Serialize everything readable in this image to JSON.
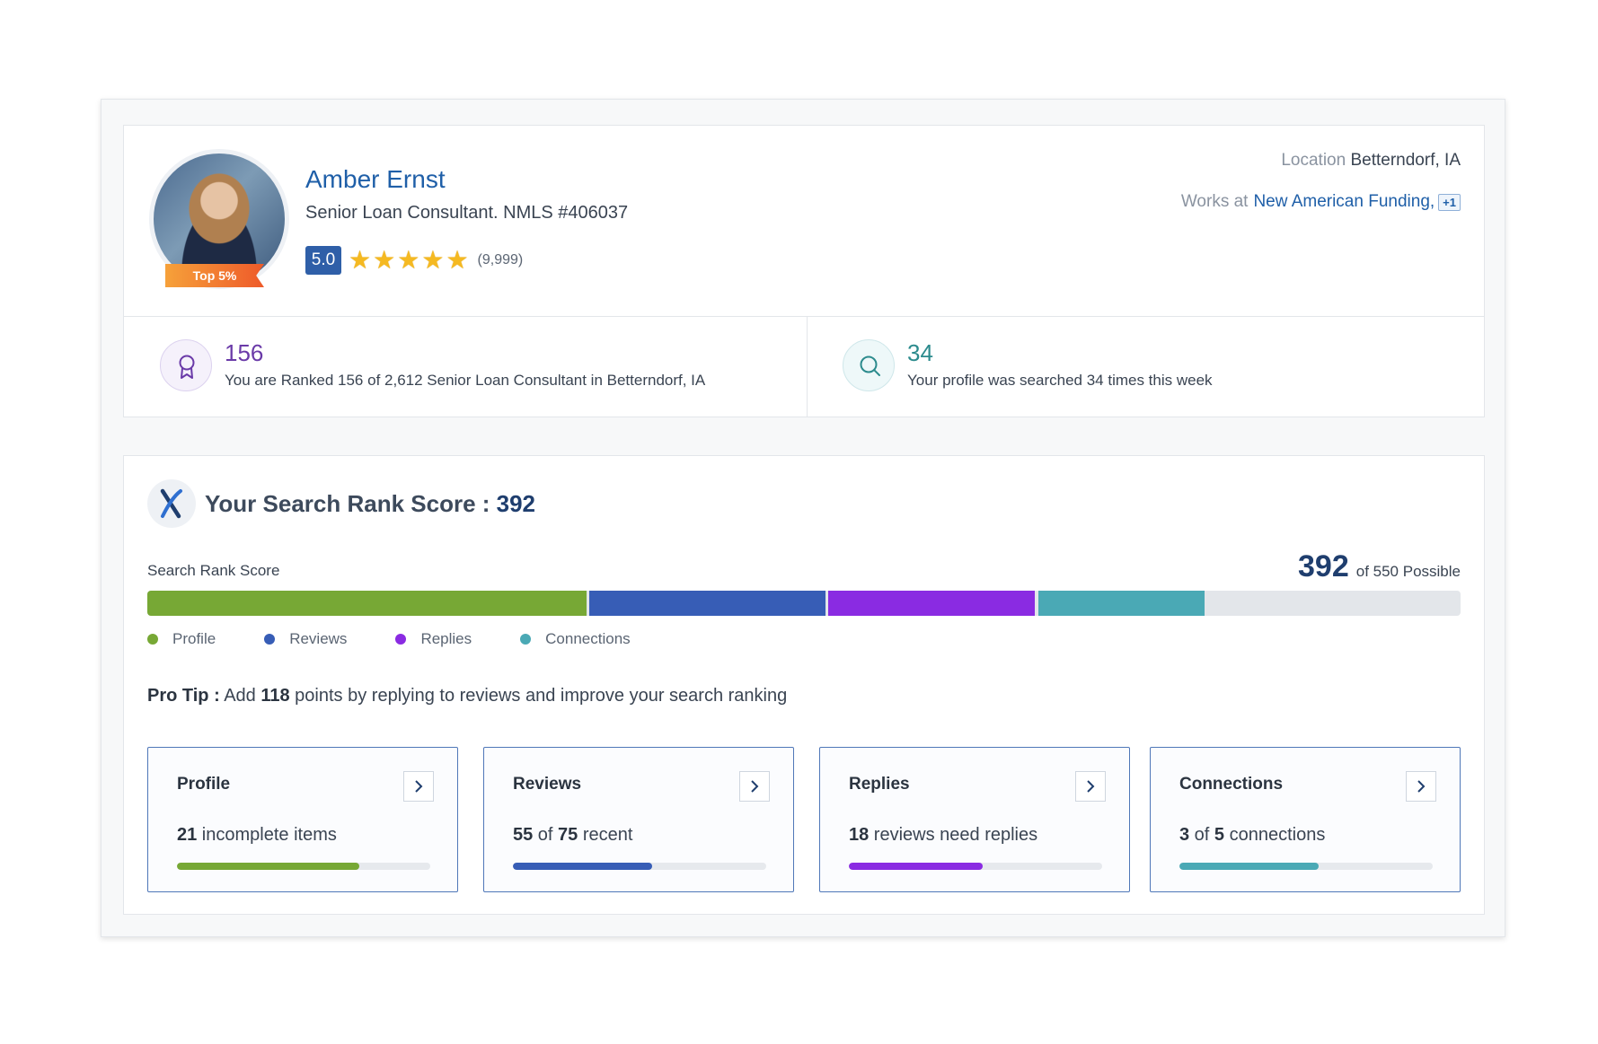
{
  "profile": {
    "name": "Amber Ernst",
    "title": "Senior Loan Consultant. NMLS #406037",
    "top_badge": "Top 5%",
    "rating": "5.0",
    "stars": 5,
    "rating_count": "(9,999)",
    "location_label": "Location",
    "location": "Betterndorf, IA",
    "works_label": "Works at",
    "company": "New American Funding,",
    "extra_companies": "+1"
  },
  "stats": [
    {
      "icon": "ribbon-award-icon",
      "value": "156",
      "text": "You are Ranked 156 of 2,612 Senior Loan Consultant in Betterndorf, IA"
    },
    {
      "icon": "search-icon",
      "value": "34",
      "text": "Your profile was searched 34 times this week"
    }
  ],
  "score": {
    "heading": "Your Search Rank Score : ",
    "value": "392",
    "bar_label": "Search Rank Score",
    "total_value": "392",
    "total_suffix": "of 550 Possible",
    "max": 550,
    "segments": [
      {
        "name": "Profile",
        "points": 185,
        "color": "#77a835"
      },
      {
        "name": "Reviews",
        "points": 100,
        "color": "#375db6"
      },
      {
        "name": "Replies",
        "points": 88,
        "color": "#8a2be2"
      },
      {
        "name": "Connections",
        "points": 71,
        "color": "#4aa9b5"
      }
    ],
    "legend": [
      "Profile",
      "Reviews",
      "Replies",
      "Connections"
    ],
    "pro_tip_label": "Pro Tip :",
    "pro_tip_pre": " Add ",
    "pro_tip_points": "118",
    "pro_tip_post": " points by replying to reviews and improve your search ranking"
  },
  "cards": [
    {
      "title": "Profile",
      "strong": "21",
      "text": " incomplete items",
      "progress": 0.72,
      "color": "#77a835"
    },
    {
      "title": "Reviews",
      "strong": "55",
      "mid": " of ",
      "strong2": "75",
      "text": " recent",
      "progress": 0.55,
      "color": "#375db6"
    },
    {
      "title": "Replies",
      "strong": "18",
      "text": " reviews need replies",
      "progress": 0.53,
      "color": "#8a2be2"
    },
    {
      "title": "Connections",
      "strong": "3",
      "mid": " of ",
      "strong2": "5",
      "text": " connections",
      "progress": 0.55,
      "color": "#4aa9b5"
    }
  ]
}
